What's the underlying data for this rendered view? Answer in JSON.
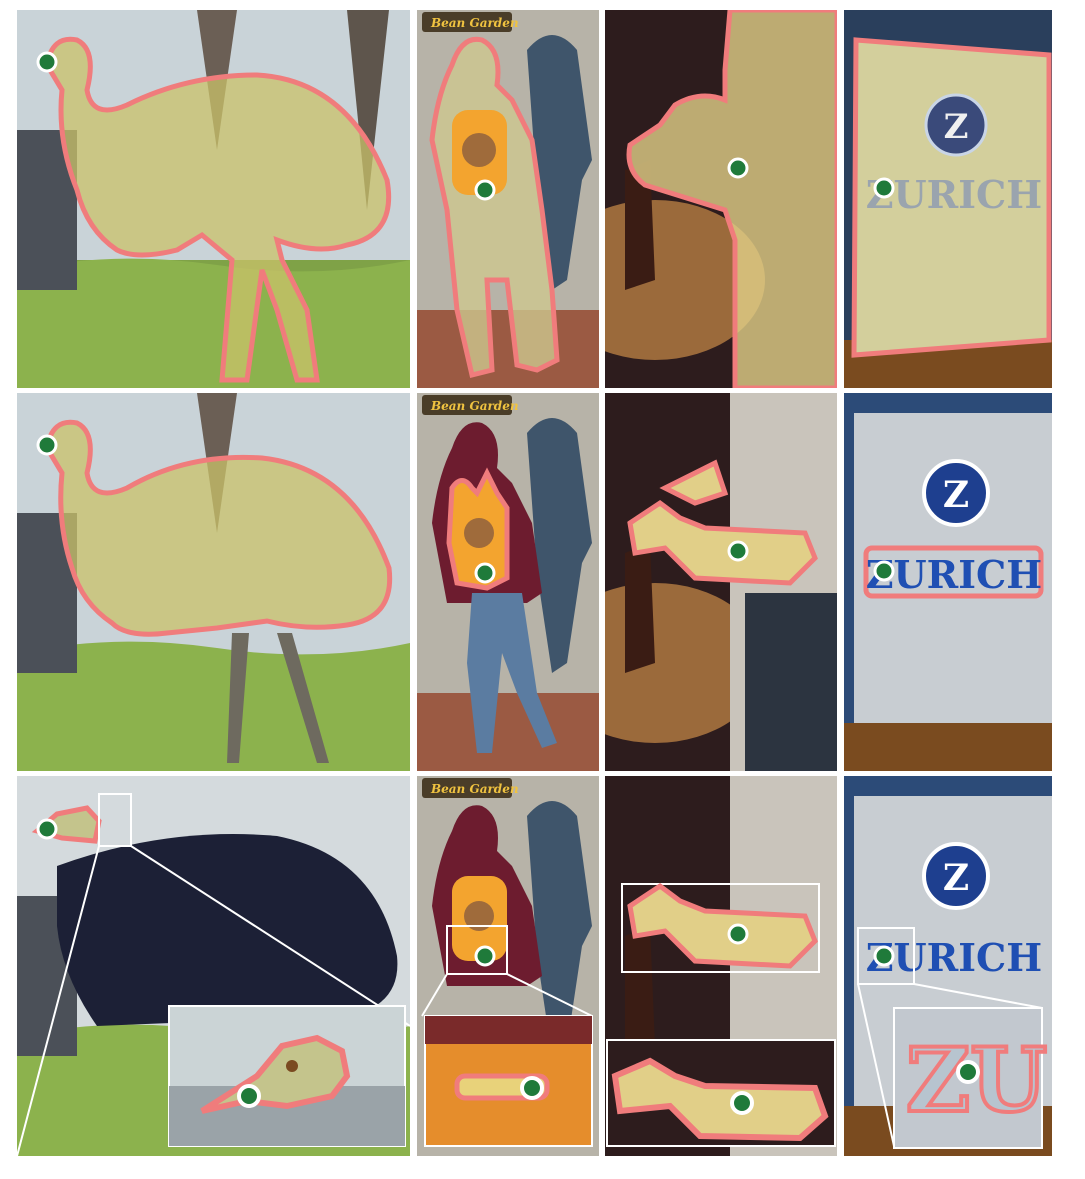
{
  "figure": {
    "rows": [
      {
        "row": 1,
        "panels": [
          "emu",
          "backpack-person",
          "arm-bottle",
          "zurich-sign"
        ]
      },
      {
        "row": 2,
        "panels": [
          "emu",
          "backpack-person",
          "arm-bottle",
          "zurich-sign"
        ]
      },
      {
        "row": 3,
        "panels": [
          "emu",
          "backpack-person",
          "arm-bottle",
          "zurich-sign"
        ]
      }
    ],
    "signage": {
      "cafe_sign": "Bean Garden",
      "logo_letter": "Z",
      "company_name": "ZURICH",
      "zoom_letters": "ZU"
    },
    "colors": {
      "mask_outline": "#f07c7c",
      "mask_fill": "#e8d27a",
      "click_point": "#1f7a3a",
      "zurich_blue": "#1f4fb3"
    }
  }
}
